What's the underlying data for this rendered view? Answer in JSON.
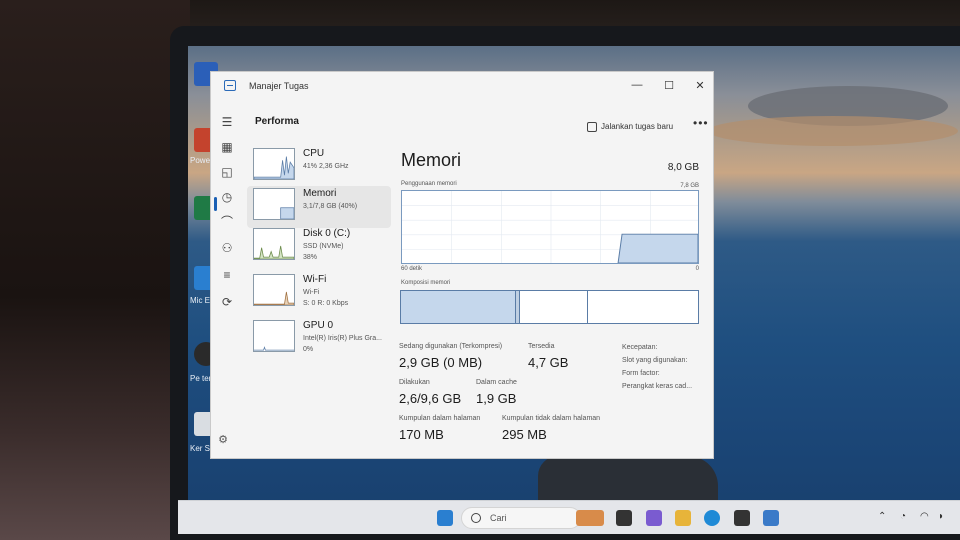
{
  "window": {
    "title": "Manajer Tugas",
    "minimize": "—",
    "maximize": "☐",
    "close": "✕"
  },
  "header": {
    "page_title": "Performa",
    "run_task_label": "Jalankan tugas baru",
    "more_label": "•••"
  },
  "devices": [
    {
      "name": "CPU",
      "sub1": "41%  2,36 GHz",
      "sub2": ""
    },
    {
      "name": "Memori",
      "sub1": "3,1/7,8 GB (40%)",
      "sub2": ""
    },
    {
      "name": "Disk 0 (C:)",
      "sub1": "SSD (NVMe)",
      "sub2": "38%"
    },
    {
      "name": "Wi-Fi",
      "sub1": "Wi-Fi",
      "sub2": "S: 0 R: 0 Kbps"
    },
    {
      "name": "GPU 0",
      "sub1": "Intel(R) Iris(R) Plus Gra...",
      "sub2": "0%"
    }
  ],
  "memory": {
    "title": "Memori",
    "total": "8,0 GB",
    "usage_label": "Penggunaan memori",
    "usage_max": "7,8 GB",
    "time_label": "60 detik",
    "time_zero": "0",
    "composition_label": "Komposisi memori",
    "in_use_label": "Sedang digunakan (Terkompresi)",
    "in_use_value": "2,9 GB (0 MB)",
    "available_label": "Tersedia",
    "available_value": "4,7 GB",
    "committed_label": "Dilakukan",
    "committed_value": "2,6/9,6 GB",
    "cached_label": "Dalam cache",
    "cached_value": "1,9 GB",
    "paged_pool_label": "Kumpulan dalam halaman",
    "paged_pool_value": "170 MB",
    "nonpaged_pool_label": "Kumpulan tidak dalam halaman",
    "nonpaged_pool_value": "295 MB",
    "meta": [
      "Kecepatan:",
      "Slot yang digunakan:",
      "Form factor:",
      "Perangkat keras cad..."
    ],
    "usage_percent": 40
  },
  "taskbar": {
    "search_placeholder": "Cari"
  },
  "desktop": {
    "labels": [
      "Powe",
      "Mic E",
      "Pe tent",
      "Ker Sampah"
    ]
  },
  "colors": {
    "accent": "#1a5fb4",
    "memory_fill": "#c5d7ec",
    "memory_border": "#5a7ca6"
  }
}
